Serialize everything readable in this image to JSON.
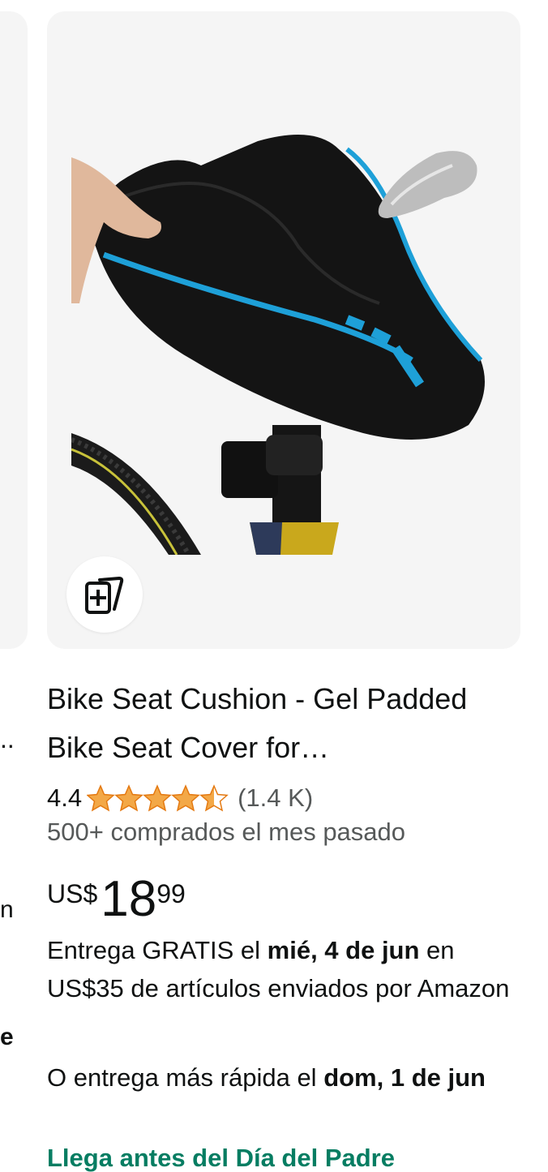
{
  "left_card": {
    "text_lines": [
      "..",
      "n",
      "e"
    ]
  },
  "product": {
    "title": "Bike Seat Cushion - Gel Padded Bike Seat Cover for…",
    "rating": "4.4",
    "stars_value": 4.4,
    "rating_count": "(1.4 K)",
    "bought": "500+ comprados el mes pasado",
    "price": {
      "currency": "US$",
      "whole": "18",
      "fraction": "99"
    },
    "delivery": {
      "prefix": "Entrega GRATIS el ",
      "date": "mié, 4 de jun",
      "suffix": " en US$35 de artículos enviados por Amazon"
    },
    "faster": {
      "prefix": "O entrega más rápida el ",
      "date": "dom, 1 de jun"
    },
    "promo": "Llega antes del Día del Padre"
  },
  "icons": {
    "compare": "add-to-compare-icon",
    "star": "star-icon"
  },
  "colors": {
    "star": "#f3a847",
    "promo": "#067d62",
    "card_bg": "#f5f5f5",
    "muted_text": "#565959"
  }
}
